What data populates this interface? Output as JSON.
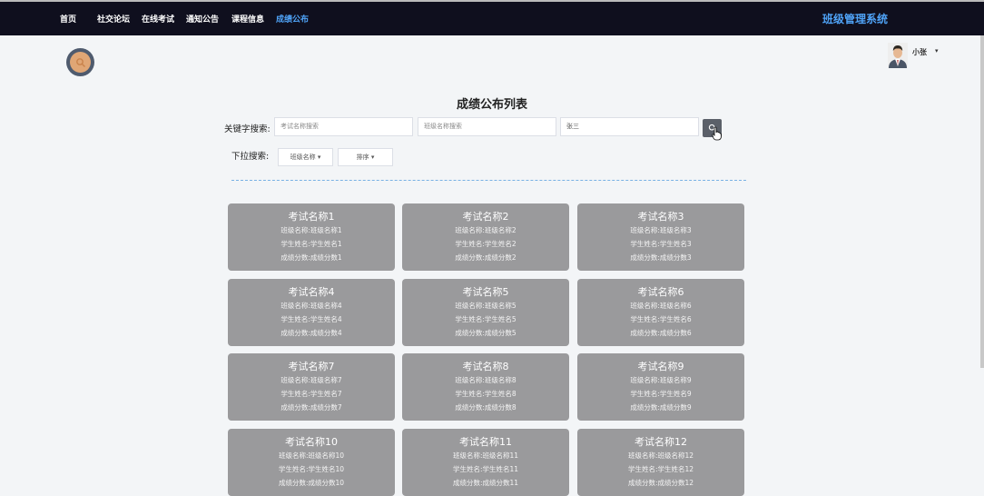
{
  "nav": {
    "items": [
      "首页",
      "社交论坛",
      "在线考试",
      "通知公告",
      "课程信息",
      "成绩公布"
    ],
    "active_index": 5,
    "brand": "班级管理系统"
  },
  "user": {
    "name": "小张"
  },
  "page": {
    "title": "成绩公布列表"
  },
  "search": {
    "keyword_label": "关键字搜索:",
    "exam_placeholder": "考试名称搜索",
    "class_placeholder": "班级名称搜索",
    "student_value": "张三",
    "dropdown_label": "下拉搜索:",
    "class_dropdown": "班级名称",
    "sort_dropdown": "排序"
  },
  "cards": [
    {
      "title": "考试名称1",
      "class_line": "班级名称:班级名称1",
      "student_line": "学生姓名:学生姓名1",
      "score_line": "成绩分数:成绩分数1"
    },
    {
      "title": "考试名称2",
      "class_line": "班级名称:班级名称2",
      "student_line": "学生姓名:学生姓名2",
      "score_line": "成绩分数:成绩分数2"
    },
    {
      "title": "考试名称3",
      "class_line": "班级名称:班级名称3",
      "student_line": "学生姓名:学生姓名3",
      "score_line": "成绩分数:成绩分数3"
    },
    {
      "title": "考试名称4",
      "class_line": "班级名称:班级名称4",
      "student_line": "学生姓名:学生姓名4",
      "score_line": "成绩分数:成绩分数4"
    },
    {
      "title": "考试名称5",
      "class_line": "班级名称:班级名称5",
      "student_line": "学生姓名:学生姓名5",
      "score_line": "成绩分数:成绩分数5"
    },
    {
      "title": "考试名称6",
      "class_line": "班级名称:班级名称6",
      "student_line": "学生姓名:学生姓名6",
      "score_line": "成绩分数:成绩分数6"
    },
    {
      "title": "考试名称7",
      "class_line": "班级名称:班级名称7",
      "student_line": "学生姓名:学生姓名7",
      "score_line": "成绩分数:成绩分数7"
    },
    {
      "title": "考试名称8",
      "class_line": "班级名称:班级名称8",
      "student_line": "学生姓名:学生姓名8",
      "score_line": "成绩分数:成绩分数8"
    },
    {
      "title": "考试名称9",
      "class_line": "班级名称:班级名称9",
      "student_line": "学生姓名:学生姓名9",
      "score_line": "成绩分数:成绩分数9"
    },
    {
      "title": "考试名称10",
      "class_line": "班级名称:班级名称10",
      "student_line": "学生姓名:学生姓名10",
      "score_line": "成绩分数:成绩分数10"
    },
    {
      "title": "考试名称11",
      "class_line": "班级名称:班级名称11",
      "student_line": "学生姓名:学生姓名11",
      "score_line": "成绩分数:成绩分数11"
    },
    {
      "title": "考试名称12",
      "class_line": "班级名称:班级名称12",
      "student_line": "学生姓名:学生姓名12",
      "score_line": "成绩分数:成绩分数12"
    }
  ],
  "colors": {
    "nav_bg": "#0f0f1e",
    "accent": "#4fa3f7",
    "card_bg": "#9a9a9c",
    "button_bg": "#5b6069"
  }
}
